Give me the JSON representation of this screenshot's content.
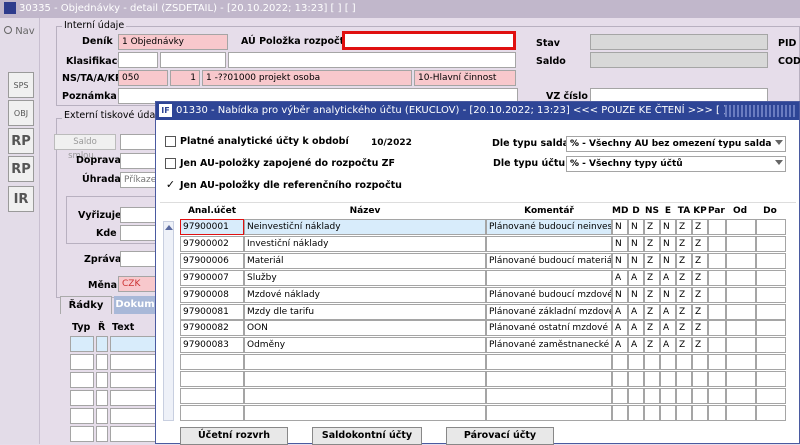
{
  "bg": {
    "title": "30335 - Objednávky - detail (ZSDETAIL) - [20.10.2022; 13:23] [ ] [ ]",
    "nav_label": "Nav",
    "section_internal": "Interní údaje",
    "section_external": "Externí tiskové údaje",
    "denik_label": "Deník",
    "denik_value": "1 Objednávky",
    "au_label": "AÚ Položka rozpočtu",
    "stav_label": "Stav",
    "pid_label": "PID",
    "klasifikace_label": "Klasifikace",
    "saldo_label": "Saldo",
    "cod_label": "COD",
    "ns_label": "NS/TA/A/KP",
    "ns_values": [
      "050",
      "1",
      "1 -??01000 projekt osoba",
      "10-Hlavní činnost"
    ],
    "poznamka_label": "Poznámka",
    "vz_label": "VZ číslo",
    "saldo_smlou": "Saldo smlou...",
    "doprava_label": "Doprava",
    "uhrada_label": "Úhrada",
    "uhrada_value": "Příkaze",
    "vyrizuje_label": "Vyřizuje",
    "kde_label": "Kde",
    "zprava_label": "Zpráva",
    "mena_label": "Měna",
    "mena_value": "CZK",
    "tabs": [
      "Řádky",
      "Dokum"
    ],
    "cols": [
      "Typ",
      "Ř",
      "Text"
    ],
    "tool_icons": [
      "SPS",
      "OBJ",
      "RP",
      "RP",
      "IR"
    ]
  },
  "modal": {
    "title": "01330 - Nabídka pro výběr analytického účtu (EKUCLOV) - [20.10.2022; 13:23] <<< POUZE KE ČTENÍ >>> [ ] [ ]",
    "chk1_label": "Platné analytické účty k období",
    "period": "10/2022",
    "chk2_label": "Jen AU-položky zapojené do rozpočtu ZF",
    "chk3_label": "Jen AU-položky dle referenčního rozpočtu",
    "dle_salda_label": "Dle typu salda",
    "dle_salda_value": "% - Všechny AU bez omezení typu salda",
    "dle_uctu_label": "Dle typu účtu",
    "dle_uctu_value": "% - Všechny typy účtů",
    "headers": [
      "Anal.účet",
      "Název",
      "Komentář",
      "MD",
      "D",
      "NS",
      "E",
      "TA",
      "KP",
      "Par",
      "Od",
      "Do"
    ],
    "rows": [
      {
        "ucet": "97900001",
        "nazev": "Neinvestiční náklady",
        "koment": "Plánované budoucí neinvestič",
        "f": [
          "N",
          "N",
          "Z",
          "N",
          "Z",
          "Z"
        ]
      },
      {
        "ucet": "97900002",
        "nazev": "Investiční náklady",
        "koment": "",
        "f": [
          "N",
          "N",
          "Z",
          "N",
          "Z",
          "Z"
        ]
      },
      {
        "ucet": "97900006",
        "nazev": "Materiál",
        "koment": "Plánované budoucí materiálov",
        "f": [
          "N",
          "N",
          "Z",
          "N",
          "Z",
          "Z"
        ]
      },
      {
        "ucet": "97900007",
        "nazev": "Služby",
        "koment": "",
        "f": [
          "A",
          "A",
          "Z",
          "A",
          "Z",
          "Z"
        ]
      },
      {
        "ucet": "97900008",
        "nazev": "Mzdové náklady",
        "koment": "Plánované budoucí mzdové n",
        "f": [
          "N",
          "N",
          "Z",
          "N",
          "Z",
          "Z"
        ]
      },
      {
        "ucet": "97900081",
        "nazev": "Mzdy dle tarifu",
        "koment": "Plánované základní mzdové n",
        "f": [
          "A",
          "A",
          "Z",
          "A",
          "Z",
          "Z"
        ]
      },
      {
        "ucet": "97900082",
        "nazev": "OON",
        "koment": "Plánované ostatní mzdové ná",
        "f": [
          "A",
          "A",
          "Z",
          "A",
          "Z",
          "Z"
        ]
      },
      {
        "ucet": "97900083",
        "nazev": "Odměny",
        "koment": "Plánované zaměstnanecké o",
        "f": [
          "A",
          "A",
          "Z",
          "A",
          "Z",
          "Z"
        ]
      }
    ],
    "buttons": [
      "Účetní rozvrh",
      "Saldokontní účty",
      "Párovací účty"
    ]
  }
}
